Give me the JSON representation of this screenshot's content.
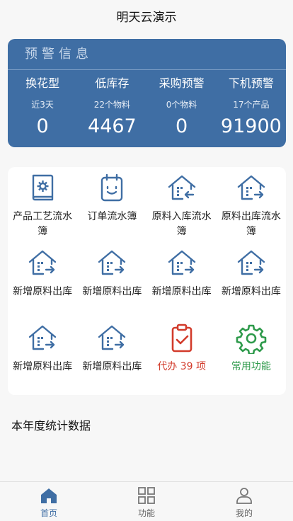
{
  "header": {
    "title": "明天云演示"
  },
  "warning": {
    "title": "预警信息",
    "items": [
      {
        "name": "换花型",
        "sub": "近3天",
        "value": "0"
      },
      {
        "name": "低库存",
        "sub": "22个物料",
        "value": "4467"
      },
      {
        "name": "采购预警",
        "sub": "0个物料",
        "value": "0"
      },
      {
        "name": "下机预警",
        "sub": "17个产品",
        "value": "91900"
      }
    ]
  },
  "grid": {
    "items": [
      {
        "label": "产品工艺流水簿",
        "icon": "book-gear-icon"
      },
      {
        "label": "订单流水簿",
        "icon": "notebook-smile-icon"
      },
      {
        "label": "原料入库流水簿",
        "icon": "warehouse-in-icon"
      },
      {
        "label": "原料出库流水簿",
        "icon": "warehouse-out-icon"
      },
      {
        "label": "新增原料出库",
        "icon": "warehouse-out-icon"
      },
      {
        "label": "新增原料出库",
        "icon": "warehouse-out-icon"
      },
      {
        "label": "新增原料出库",
        "icon": "warehouse-out-icon"
      },
      {
        "label": "新增原料出库",
        "icon": "warehouse-out-icon"
      },
      {
        "label": "新增原料出库",
        "icon": "warehouse-out-icon"
      },
      {
        "label": "新增原料出库",
        "icon": "warehouse-out-icon"
      },
      {
        "label": "代办 39 项",
        "icon": "clipboard-check-icon"
      },
      {
        "label": "常用功能",
        "icon": "gear-icon"
      }
    ]
  },
  "section": {
    "title": "本年度统计数据"
  },
  "tabbar": {
    "tabs": [
      {
        "label": "首页",
        "icon": "home-icon",
        "active": true
      },
      {
        "label": "功能",
        "icon": "grid-icon",
        "active": false
      },
      {
        "label": "我的",
        "icon": "user-icon",
        "active": false
      }
    ]
  },
  "colors": {
    "primary": "#3f6ea4",
    "red": "#d23b2b",
    "green": "#2e9a4b"
  }
}
